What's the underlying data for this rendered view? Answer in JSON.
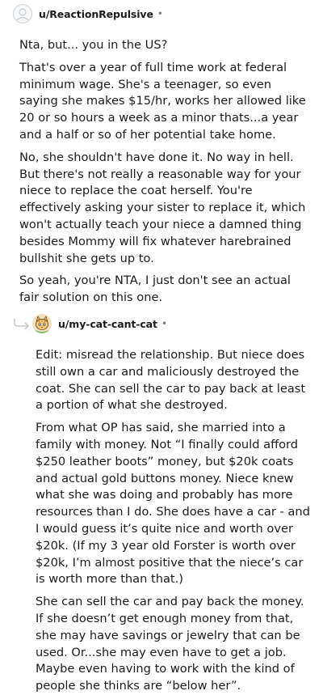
{
  "comments": [
    {
      "username": "u/ReactionRepulsive",
      "separator": "•",
      "avatar_icon": "default-avatar-icon",
      "paragraphs": [
        "Nta, but... you in the US?",
        "That's over a year of full time work at federal minimum wage. She's a teenager, so even saying she makes $15/hr, works her allowed like 20 or so hours a week as a minor thats...a year and a half or so of her potential take home.",
        "No, she shouldn't have done it. No way in hell. But there's not really a reasonable way for your niece to replace the coat herself. You're effectively asking your sister to replace it, which won't actually teach your niece a damned thing besides Mommy will fix whatever harebrained bullshit she gets up to.",
        "So yeah, you're NTA, I just don't see an actual fair solution on this one."
      ]
    },
    {
      "username": "u/my-cat-cant-cat",
      "separator": "•",
      "avatar_icon": "cat-avatar-icon",
      "reply_icon": "reply-arrow-icon",
      "paragraphs": [
        "Edit: misread the relationship. But niece does still own a car and maliciously destroyed the coat. She can sell the car to pay back at least a portion of what she destroyed.",
        "From what OP has said, she married into a family with money. Not “I finally could afford $250 leather boots” money, but $20k coats and actual gold buttons money. Niece knew what she was doing and probably has more resources than I do. She does have a car - and I would guess it’s quite nice and worth over $20k. (If my 3 year old Forster is worth over $20k, I’m almost positive that the niece’s car is worth more than that.)",
        "She can sell the car and pay back the money. If she doesn’t get enough money from that, she may have savings or jewelry that can be used. Or...she may even have to get a job. Maybe even having to work with the kind of people she thinks are “below her”."
      ]
    }
  ]
}
